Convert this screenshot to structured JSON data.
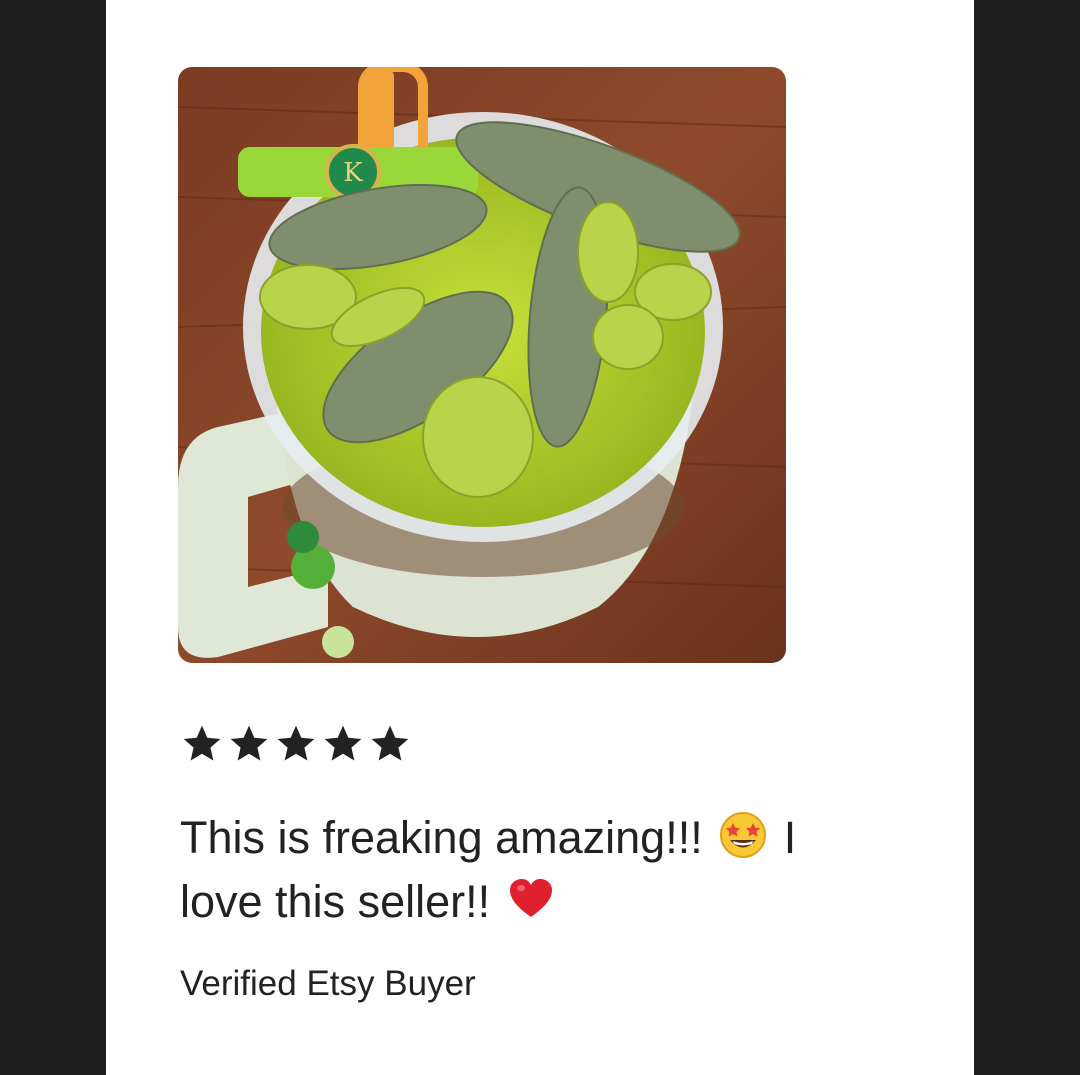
{
  "review": {
    "rating": 5,
    "rating_max": 5,
    "text_part1": "This is freaking amazing!!!",
    "emoji_star_struck": "star-struck-emoji",
    "text_part2": "I",
    "text_part3": "love this seller!!",
    "emoji_heart": "red-heart-emoji",
    "reviewer": "Verified Etsy Buyer"
  },
  "colors": {
    "page_bg": "#1e1e1e",
    "card_bg": "#ffffff",
    "text": "#222222",
    "star": "#222222"
  },
  "icons": [
    "star-icon",
    "star-struck-emoji",
    "red-heart-emoji"
  ]
}
